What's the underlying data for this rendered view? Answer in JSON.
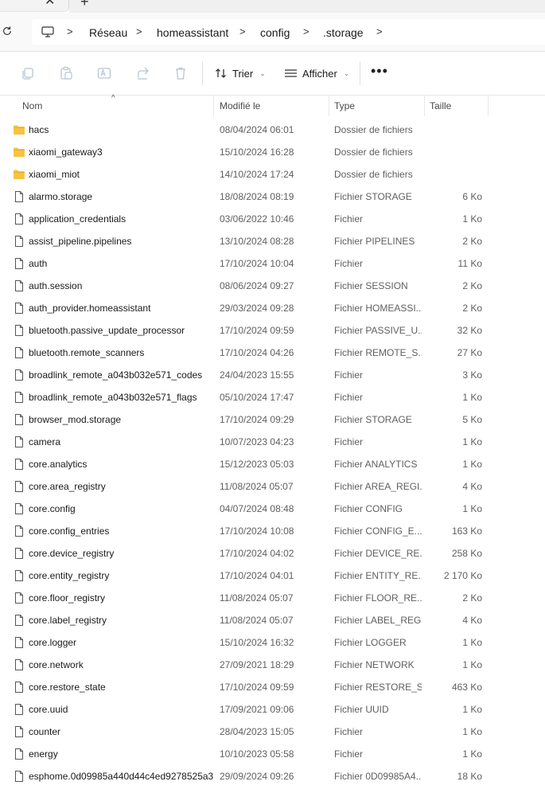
{
  "window": {
    "tab_close_glyph": "✕",
    "tab_new_glyph": "+"
  },
  "address": {
    "root_icon": "monitor-icon",
    "crumbs": [
      "Réseau",
      "homeassistant",
      "config",
      ".storage"
    ]
  },
  "toolbar": {
    "icons": [
      "copy-icon",
      "paste-icon",
      "rename-icon",
      "share-icon",
      "delete-icon"
    ],
    "sort_label": "Trier",
    "view_label": "Afficher",
    "more_label": "•••"
  },
  "columns": {
    "name": "Nom",
    "modified": "Modifié le",
    "type": "Type",
    "size": "Taille"
  },
  "files": [
    {
      "name": "hacs",
      "date": "08/04/2024 06:01",
      "type": "Dossier de fichiers",
      "size": "",
      "kind": "folder"
    },
    {
      "name": "xiaomi_gateway3",
      "date": "15/10/2024 16:28",
      "type": "Dossier de fichiers",
      "size": "",
      "kind": "folder"
    },
    {
      "name": "xiaomi_miot",
      "date": "14/10/2024 17:24",
      "type": "Dossier de fichiers",
      "size": "",
      "kind": "folder"
    },
    {
      "name": "alarmo.storage",
      "date": "18/08/2024 08:19",
      "type": "Fichier STORAGE",
      "size": "6 Ko",
      "kind": "file"
    },
    {
      "name": "application_credentials",
      "date": "03/06/2022 10:46",
      "type": "Fichier",
      "size": "1 Ko",
      "kind": "file"
    },
    {
      "name": "assist_pipeline.pipelines",
      "date": "13/10/2024 08:28",
      "type": "Fichier PIPELINES",
      "size": "2 Ko",
      "kind": "file"
    },
    {
      "name": "auth",
      "date": "17/10/2024 10:04",
      "type": "Fichier",
      "size": "11 Ko",
      "kind": "file"
    },
    {
      "name": "auth.session",
      "date": "08/06/2024 09:27",
      "type": "Fichier SESSION",
      "size": "2 Ko",
      "kind": "file"
    },
    {
      "name": "auth_provider.homeassistant",
      "date": "29/03/2024 09:28",
      "type": "Fichier HOMEASSI...",
      "size": "2 Ko",
      "kind": "file"
    },
    {
      "name": "bluetooth.passive_update_processor",
      "date": "17/10/2024 09:59",
      "type": "Fichier PASSIVE_U...",
      "size": "32 Ko",
      "kind": "file"
    },
    {
      "name": "bluetooth.remote_scanners",
      "date": "17/10/2024 04:26",
      "type": "Fichier REMOTE_S...",
      "size": "27 Ko",
      "kind": "file"
    },
    {
      "name": "broadlink_remote_a043b032e571_codes",
      "date": "24/04/2023 15:55",
      "type": "Fichier",
      "size": "3 Ko",
      "kind": "file"
    },
    {
      "name": "broadlink_remote_a043b032e571_flags",
      "date": "05/10/2024 17:47",
      "type": "Fichier",
      "size": "1 Ko",
      "kind": "file"
    },
    {
      "name": "browser_mod.storage",
      "date": "17/10/2024 09:29",
      "type": "Fichier STORAGE",
      "size": "5 Ko",
      "kind": "file"
    },
    {
      "name": "camera",
      "date": "10/07/2023 04:23",
      "type": "Fichier",
      "size": "1 Ko",
      "kind": "file"
    },
    {
      "name": "core.analytics",
      "date": "15/12/2023 05:03",
      "type": "Fichier ANALYTICS",
      "size": "1 Ko",
      "kind": "file"
    },
    {
      "name": "core.area_registry",
      "date": "11/08/2024 05:07",
      "type": "Fichier AREA_REGI...",
      "size": "4 Ko",
      "kind": "file"
    },
    {
      "name": "core.config",
      "date": "04/07/2024 08:48",
      "type": "Fichier CONFIG",
      "size": "1 Ko",
      "kind": "file"
    },
    {
      "name": "core.config_entries",
      "date": "17/10/2024 10:08",
      "type": "Fichier CONFIG_E...",
      "size": "163 Ko",
      "kind": "file"
    },
    {
      "name": "core.device_registry",
      "date": "17/10/2024 04:02",
      "type": "Fichier DEVICE_RE...",
      "size": "258 Ko",
      "kind": "file"
    },
    {
      "name": "core.entity_registry",
      "date": "17/10/2024 04:01",
      "type": "Fichier ENTITY_RE...",
      "size": "2 170 Ko",
      "kind": "file"
    },
    {
      "name": "core.floor_registry",
      "date": "11/08/2024 05:07",
      "type": "Fichier FLOOR_RE...",
      "size": "2 Ko",
      "kind": "file"
    },
    {
      "name": "core.label_registry",
      "date": "11/08/2024 05:07",
      "type": "Fichier LABEL_REG...",
      "size": "4 Ko",
      "kind": "file"
    },
    {
      "name": "core.logger",
      "date": "15/10/2024 16:32",
      "type": "Fichier LOGGER",
      "size": "1 Ko",
      "kind": "file"
    },
    {
      "name": "core.network",
      "date": "27/09/2021 18:29",
      "type": "Fichier NETWORK",
      "size": "1 Ko",
      "kind": "file"
    },
    {
      "name": "core.restore_state",
      "date": "17/10/2024 09:59",
      "type": "Fichier RESTORE_S...",
      "size": "463 Ko",
      "kind": "file"
    },
    {
      "name": "core.uuid",
      "date": "17/09/2021 09:06",
      "type": "Fichier UUID",
      "size": "1 Ko",
      "kind": "file"
    },
    {
      "name": "counter",
      "date": "28/04/2023 15:05",
      "type": "Fichier",
      "size": "1 Ko",
      "kind": "file"
    },
    {
      "name": "energy",
      "date": "10/10/2023 05:58",
      "type": "Fichier",
      "size": "1 Ko",
      "kind": "file"
    },
    {
      "name": "esphome.0d09985a440d44c4ed9278525a3...",
      "date": "29/09/2024 09:26",
      "type": "Fichier 0D09985A4...",
      "size": "18 Ko",
      "kind": "file"
    }
  ],
  "colors": {
    "folder": "#f6c343",
    "folder_dark": "#e3a92b",
    "icon_muted": "#b8c4d6",
    "header_text": "#4a4a4a"
  }
}
